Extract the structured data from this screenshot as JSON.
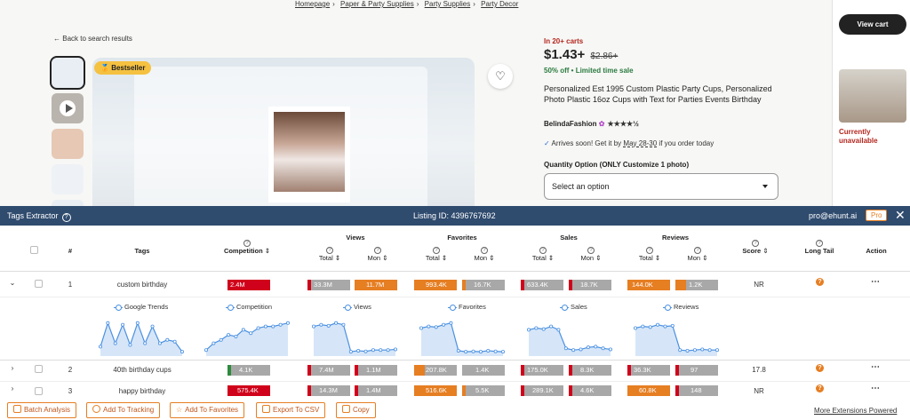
{
  "breadcrumb": [
    "Homepage",
    "Paper & Party Supplies",
    "Party Supplies",
    "Party Decor"
  ],
  "back_link": "Back to search results",
  "bestseller_badge": "Bestseller",
  "listing": {
    "in_carts": "In 20+ carts",
    "price": "$1.43+",
    "old_price": "$2.86+",
    "sale": "50% off • Limited time sale",
    "title": "Personalized Est 1995 Custom Plastic Party Cups, Personalized Photo Plastic 16oz Cups with Text for Parties Events Birthday",
    "shop": "BelindaFashion",
    "stars": "★★★★½",
    "arrival_pre": "Arrives soon! Get it by ",
    "arrival_date": "May 28-30",
    "arrival_post": " if you order today",
    "quantity_label": "Quantity Option (ONLY Customize 1 photo)",
    "select_placeholder": "Select an option"
  },
  "cart": {
    "view_cart": "View cart",
    "unavailable": "Currently unavailable"
  },
  "extension": {
    "title": "Tags Extractor",
    "listing_id": "Listing ID:  4396767692",
    "user": "pro@ehunt.ai",
    "plan": "Pro",
    "columns": {
      "num": "#",
      "tags": "Tags",
      "competition": "Competition",
      "views": "Views",
      "favorites": "Favorites",
      "sales": "Sales",
      "reviews": "Reviews",
      "total": "Total",
      "mon": "Mon",
      "score": "Score",
      "long_tail": "Long Tail",
      "action": "Action"
    },
    "rows": [
      {
        "n": "1",
        "tag": "custom birthday",
        "competition": "2.4M",
        "views_total": "33.3M",
        "views_mon": "11.7M",
        "fav_total": "993.4K",
        "fav_mon": "16.7K",
        "sales_total": "633.4K",
        "sales_mon": "18.7K",
        "rev_total": "144.0K",
        "rev_mon": "1.2K",
        "score": "NR"
      },
      {
        "n": "2",
        "tag": "40th birthday cups",
        "competition": "4.1K",
        "views_total": "7.4M",
        "views_mon": "1.1M",
        "fav_total": "207.8K",
        "fav_mon": "1.4K",
        "sales_total": "175.0K",
        "sales_mon": "8.3K",
        "rev_total": "36.3K",
        "rev_mon": "97",
        "score": "17.8"
      },
      {
        "n": "3",
        "tag": "happy birthday",
        "competition": "575.4K",
        "views_total": "14.3M",
        "views_mon": "1.4M",
        "fav_total": "516.6K",
        "fav_mon": "5.5K",
        "sales_total": "289.1K",
        "sales_mon": "4.6K",
        "rev_total": "60.8K",
        "rev_mon": "148",
        "score": "NR"
      }
    ],
    "trends": [
      {
        "label": "Google Trends",
        "values": [
          0.2,
          0.9,
          0.3,
          0.85,
          0.25,
          0.9,
          0.3,
          0.8,
          0.3,
          0.4,
          0.35,
          0.05
        ]
      },
      {
        "label": "Competition",
        "values": [
          0.1,
          0.3,
          0.4,
          0.55,
          0.5,
          0.7,
          0.6,
          0.75,
          0.8,
          0.8,
          0.85,
          0.9
        ]
      },
      {
        "label": "Views",
        "values": [
          0.8,
          0.85,
          0.82,
          0.9,
          0.85,
          0.05,
          0.08,
          0.06,
          0.1,
          0.1,
          0.1,
          0.12
        ]
      },
      {
        "label": "Favorites",
        "values": [
          0.75,
          0.8,
          0.78,
          0.85,
          0.9,
          0.08,
          0.05,
          0.06,
          0.05,
          0.08,
          0.06,
          0.05
        ]
      },
      {
        "label": "Sales",
        "values": [
          0.7,
          0.75,
          0.72,
          0.8,
          0.7,
          0.15,
          0.1,
          0.12,
          0.18,
          0.2,
          0.15,
          0.12
        ]
      },
      {
        "label": "Reviews",
        "values": [
          0.75,
          0.8,
          0.78,
          0.85,
          0.8,
          0.82,
          0.1,
          0.08,
          0.1,
          0.12,
          0.1,
          0.1
        ]
      }
    ],
    "buttons": [
      "Batch Analysis",
      "Add To Tracking",
      "Add To Favorites",
      "Export To CSV",
      "Copy"
    ],
    "more_link": "More Extensions Powered"
  },
  "colors": {
    "header": "#2f4b6e",
    "orange": "#e67e22",
    "red": "#d0021b",
    "grey": "#a8a8a8",
    "green": "#2e8b3d"
  }
}
